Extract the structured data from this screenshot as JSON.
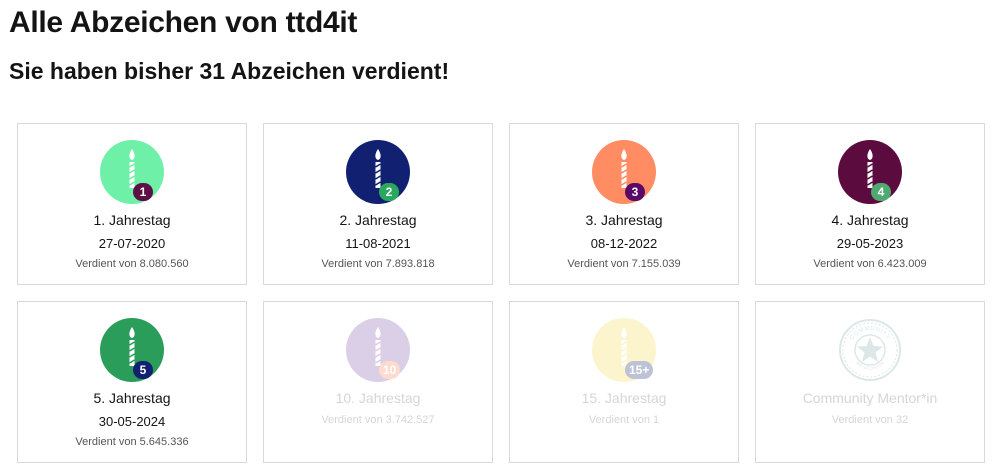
{
  "header": {
    "title": "Alle Abzeichen von ttd4it",
    "subtitle": "Sie haben bisher 31 Abzeichen verdient!"
  },
  "badges": [
    {
      "name": "1. Jahrestag",
      "date": "27-07-2020",
      "earned": "Verdient von 8.080.560",
      "number": "1",
      "icon": "birthday-candle-icon",
      "circle_color": "#6ff0a8",
      "num_color": "#5e1046",
      "locked": false
    },
    {
      "name": "2. Jahrestag",
      "date": "11-08-2021",
      "earned": "Verdient von 7.893.818",
      "number": "2",
      "icon": "birthday-candle-icon",
      "circle_color": "#122071",
      "num_color": "#2aa85e",
      "locked": false
    },
    {
      "name": "3. Jahrestag",
      "date": "08-12-2022",
      "earned": "Verdient von 7.155.039",
      "number": "3",
      "icon": "birthday-candle-icon",
      "circle_color": "#ff8c63",
      "num_color": "#5a0a66",
      "locked": false
    },
    {
      "name": "4. Jahrestag",
      "date": "29-05-2023",
      "earned": "Verdient von 6.423.009",
      "number": "4",
      "icon": "birthday-candle-icon",
      "circle_color": "#5c0b3e",
      "num_color": "#4eaa70",
      "locked": false
    },
    {
      "name": "5. Jahrestag",
      "date": "30-05-2024",
      "earned": "Verdient von 5.645.336",
      "number": "5",
      "icon": "birthday-candle-icon",
      "circle_color": "#2a9d5a",
      "num_color": "#122071",
      "locked": false
    },
    {
      "name": "10. Jahrestag",
      "earned": "Verdient von 3.742.527",
      "number": "10",
      "icon": "birthday-candle-icon",
      "circle_color": "#8b5fb3",
      "num_color": "#ff8c63",
      "locked": true
    },
    {
      "name": "15. Jahrestag",
      "earned": "Verdient von 1",
      "number": "15+",
      "icon": "birthday-candle-icon",
      "circle_color": "#f5dc5a",
      "num_color": "#2a3a7a",
      "locked": true
    },
    {
      "name": "Community Mentor*in",
      "earned": "Verdient von 32",
      "icon": "community-mentor-seal-icon",
      "seal_text": "COMMUNITY MENTOR*IN",
      "locked": true
    }
  ]
}
